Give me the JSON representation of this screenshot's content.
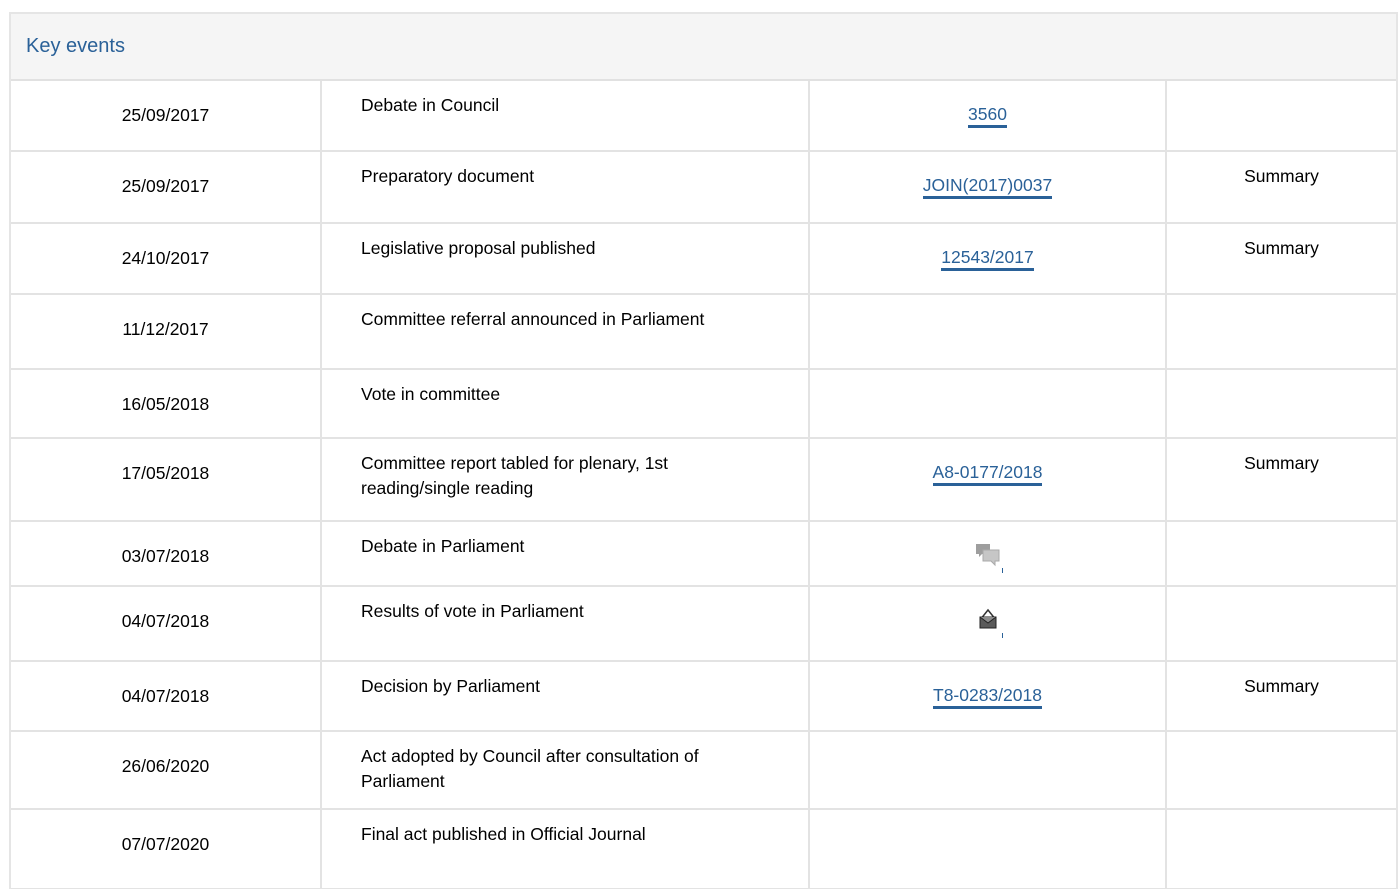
{
  "panel": {
    "title": "Key events"
  },
  "rows": [
    {
      "date": "25/09/2017",
      "event": "Debate in Council",
      "doc": "3560",
      "summary": ""
    },
    {
      "date": "25/09/2017",
      "event": "Preparatory document",
      "doc": "JOIN(2017)0037",
      "summary": "Summary"
    },
    {
      "date": "24/10/2017",
      "event": "Legislative proposal published",
      "doc": "12543/2017",
      "summary": "Summary"
    },
    {
      "date": "11/12/2017",
      "event": "Committee referral announced in Parliament",
      "doc": "",
      "summary": ""
    },
    {
      "date": "16/05/2018",
      "event": "Vote in committee",
      "doc": "",
      "summary": ""
    },
    {
      "date": "17/05/2018",
      "event": "Committee report tabled for plenary, 1st reading/single reading",
      "doc": "A8-0177/2018",
      "summary": "Summary"
    },
    {
      "date": "03/07/2018",
      "event": "Debate in Parliament",
      "doc": "",
      "doc_icon": "debate-speech-bubbles-icon",
      "summary": ""
    },
    {
      "date": "04/07/2018",
      "event": "Results of vote in Parliament",
      "doc": "",
      "doc_icon": "ballot-box-icon",
      "summary": ""
    },
    {
      "date": "04/07/2018",
      "event": "Decision by Parliament",
      "doc": "T8-0283/2018",
      "summary": "Summary"
    },
    {
      "date": "26/06/2020",
      "event": "Act adopted by Council after consultation of Parliament",
      "doc": "",
      "summary": ""
    },
    {
      "date": "07/07/2020",
      "event": "Final act published in Official Journal",
      "doc": "",
      "summary": ""
    }
  ],
  "colors": {
    "link": "#2a6198",
    "header_bg": "#f5f5f5",
    "border": "#e3e3e3"
  }
}
